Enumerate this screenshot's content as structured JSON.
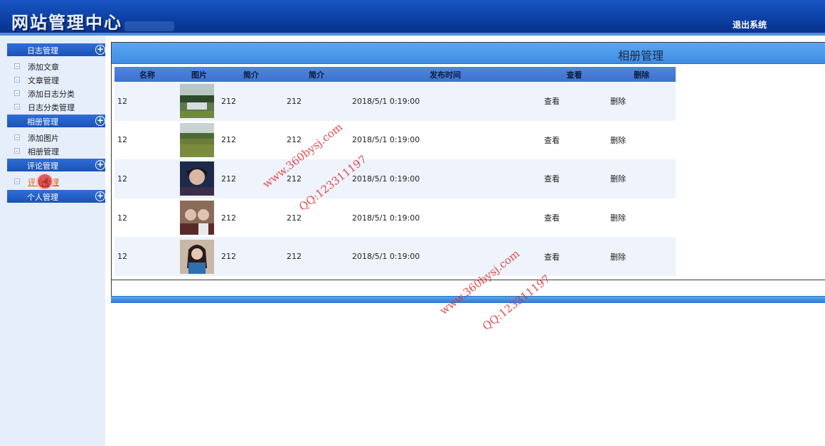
{
  "header": {
    "site_title": "网站管理中心",
    "logout_label": "退出系统"
  },
  "sidebar": {
    "sections": [
      {
        "label": "日志管理",
        "items": [
          "添加文章",
          "文章管理",
          "添加日志分类",
          "日志分类管理"
        ]
      },
      {
        "label": "相册管理",
        "items": [
          "添加图片",
          "相册管理"
        ]
      },
      {
        "label": "评论管理",
        "items": [
          "评论管理"
        ]
      },
      {
        "label": "个人管理",
        "items": []
      }
    ]
  },
  "main": {
    "title": "相册管理",
    "columns": [
      "名称",
      "图片",
      "简介",
      "简介",
      "发布时间",
      "查看",
      "删除"
    ],
    "rows": [
      {
        "name": "12",
        "intro1": "212",
        "intro2": "212",
        "time": "2018/5/1 0:19:00",
        "view": "查看",
        "delete": "删除"
      },
      {
        "name": "12",
        "intro1": "212",
        "intro2": "212",
        "time": "2018/5/1 0:19:00",
        "view": "查看",
        "delete": "删除"
      },
      {
        "name": "12",
        "intro1": "212",
        "intro2": "212",
        "time": "2018/5/1 0:19:00",
        "view": "查看",
        "delete": "删除"
      },
      {
        "name": "12",
        "intro1": "212",
        "intro2": "212",
        "time": "2018/5/1 0:19:00",
        "view": "查看",
        "delete": "删除"
      },
      {
        "name": "12",
        "intro1": "212",
        "intro2": "212",
        "time": "2018/5/1 0:19:00",
        "view": "查看",
        "delete": "删除"
      }
    ]
  },
  "watermarks": {
    "site": "www.360bysj.com",
    "qq": "QQ:123311197"
  },
  "colors": {
    "header_blue": "#0b3fa3",
    "panel_blue": "#3f8de3",
    "row_alt": "#eef3fc",
    "watermark_red": "#e22a2a",
    "active_link": "#e8570c"
  }
}
